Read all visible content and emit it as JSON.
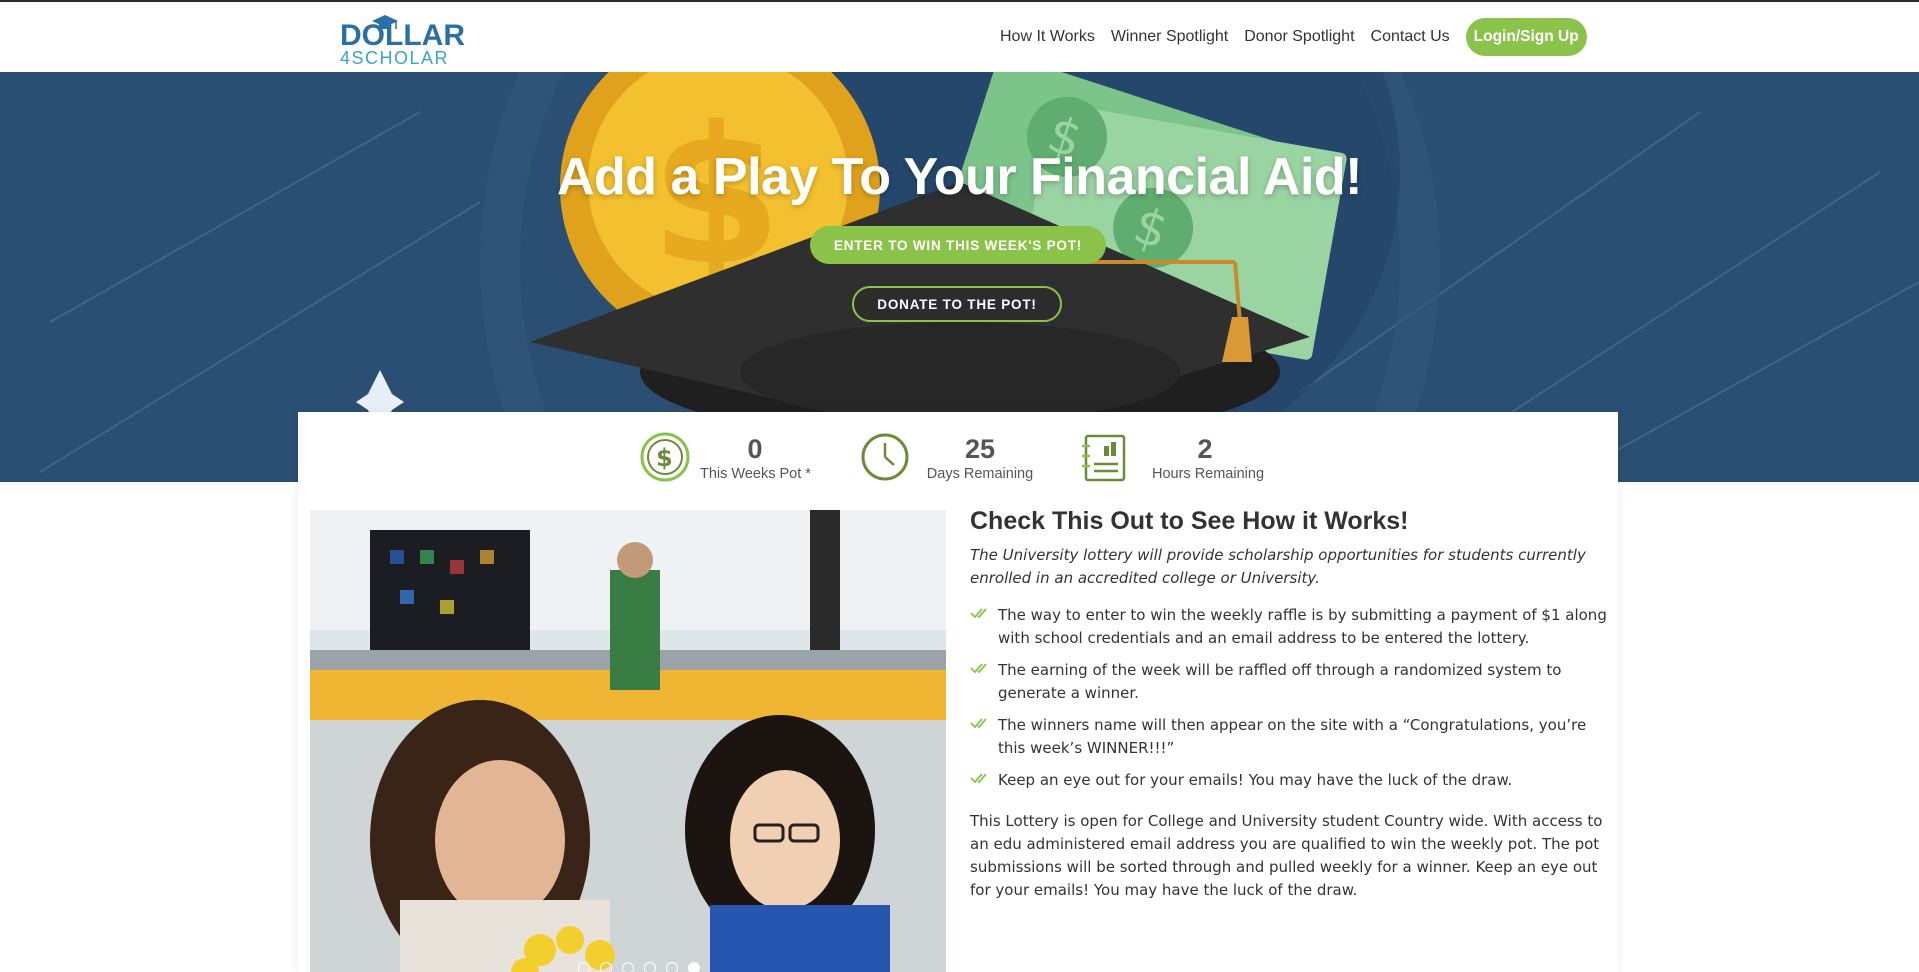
{
  "logo": {
    "line1": "DOLLAR",
    "line2": "4SCHOLAR"
  },
  "nav": {
    "items": [
      "How It Works",
      "Winner Spotlight",
      "Donor Spotlight",
      "Contact Us"
    ],
    "login": "Login/Sign Up"
  },
  "hero": {
    "title": "Add a Play To Your Financial Aid!",
    "enter_button": "ENTER TO WIN THIS WEEK'S POT!",
    "donate_button": "DONATE TO THE POT!"
  },
  "stats": [
    {
      "value": "0",
      "label": "This Weeks Pot *",
      "icon": "dollar-coin-icon"
    },
    {
      "value": "25",
      "label": "Days Remaining",
      "icon": "clock-icon"
    },
    {
      "value": "2",
      "label": "Hours Remaining",
      "icon": "checklist-icon"
    }
  ],
  "how_it_works": {
    "heading": "Check This Out to See How it Works!",
    "intro": "The University lottery will provide scholarship opportunities for students currently enrolled in an accredited college or University.",
    "bullets": [
      "The way to enter to win the weekly raffle is by submitting a payment of $1 along with school credentials and an email address to be entered the lottery.",
      "The earning of the week will be raffled off through a randomized system to generate a winner.",
      "The winners name will then appear on the site with a “Congratulations, you’re this week’s WINNER!!!”",
      "Keep an eye out for your emails! You may have the luck of the draw."
    ],
    "paragraph": "This Lottery is open for College and University student Country wide. With access to an edu administered email address you are qualified to win the weekly pot. The pot submissions will be sorted through and pulled weekly for a winner. Keep an eye out for your emails! You may have the luck of the draw."
  },
  "slider": {
    "count": 6,
    "active": 6
  },
  "colors": {
    "brand_green": "#8bc34a",
    "hero_blue": "#2a4f72",
    "icon_green": "#6d8a3a"
  }
}
